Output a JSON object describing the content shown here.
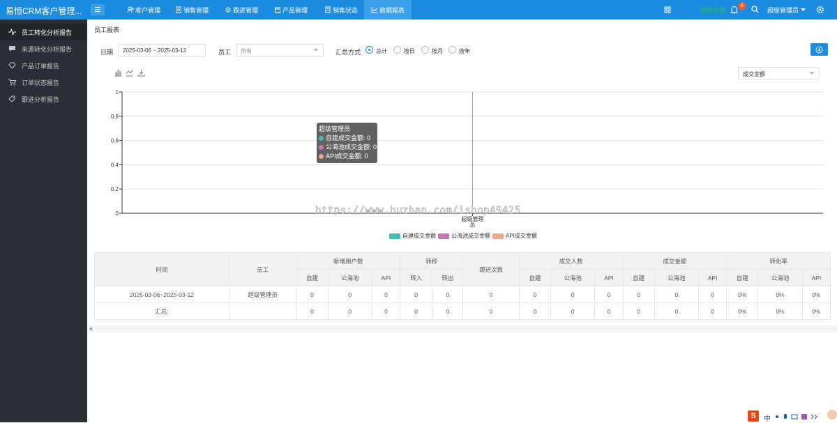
{
  "app": {
    "title": "易恒CRM客户管理..."
  },
  "nav": [
    {
      "label": "客户管理",
      "icon": "users-icon"
    },
    {
      "label": "销售管理",
      "icon": "file-icon"
    },
    {
      "label": "跟进管理",
      "icon": "gear-icon"
    },
    {
      "label": "产品管理",
      "icon": "box-icon"
    },
    {
      "label": "销售状态",
      "icon": "doc-icon"
    },
    {
      "label": "数据报表",
      "icon": "chart-icon",
      "active": true
    }
  ],
  "topright": {
    "consult": "微信咨询",
    "notify_count": "0",
    "user": "超级管理员"
  },
  "sidebar": [
    {
      "label": "员工转化分析报告",
      "icon": "pulse-icon",
      "active": true
    },
    {
      "label": "来源转化分析报告",
      "icon": "comment-icon"
    },
    {
      "label": "产品订单报告",
      "icon": "diamond-icon"
    },
    {
      "label": "订单状态报告",
      "icon": "cart-icon"
    },
    {
      "label": "跟进分析报告",
      "icon": "tag-icon"
    }
  ],
  "breadcrumb": "员工报表",
  "filters": {
    "date_label": "日期",
    "date_value": "2025-03-06 ~ 2025-03-12",
    "staff_label": "员工",
    "staff_value": "所有",
    "mode_label": "汇总方式",
    "modes": [
      "总计",
      "按日",
      "按月",
      "按年"
    ],
    "selected_mode": "总计"
  },
  "metric_select": "成交金额",
  "colors": {
    "primary": "#1c8ce0",
    "sidebar": "#2b2f35",
    "s1": "#3dbfb0",
    "s2": "#c774b5",
    "s3": "#eda88c",
    "consult": "#29c05a"
  },
  "chart_data": {
    "type": "bar",
    "categories": [
      "超级管理员"
    ],
    "series": [
      {
        "name": "自建成交金额",
        "values": [
          0
        ]
      },
      {
        "name": "公海池成交金额",
        "values": [
          0
        ]
      },
      {
        "name": "API成交金额",
        "values": [
          0
        ]
      }
    ],
    "ylim": [
      0,
      1
    ],
    "yticks": [
      "0",
      "0.2",
      "0.4",
      "0.6",
      "0.8",
      "1"
    ],
    "grid": true,
    "legend": "bottom"
  },
  "tooltip": {
    "title": "超级管理员",
    "rows": [
      "自建成交金额: 0",
      "公海池成交金额: 0",
      "API成交金额: 0"
    ]
  },
  "watermark": "https://www.huzhan.com/ishop49425",
  "table": {
    "head_top": [
      "时间",
      "员工",
      "新增用户数",
      "转移",
      "跟进次数",
      "成交人数",
      "成交金额",
      "转化率"
    ],
    "head_sub": [
      "自建",
      "公海池",
      "API",
      "转入",
      "转出",
      "自建",
      "公海池",
      "API",
      "自建",
      "公海池",
      "API",
      "自建",
      "公海池",
      "API"
    ],
    "rows": [
      [
        "2025-03-06~2025-03-12",
        "超级管理员",
        "0",
        "0",
        "0",
        "0",
        "0",
        "0",
        "0",
        "0",
        "0",
        "0",
        "0",
        "0",
        "0%",
        "0%",
        "0%"
      ],
      [
        "汇总:",
        "",
        "0",
        "0",
        "0",
        "0",
        "0",
        "0",
        "0",
        "0",
        "0",
        "0",
        "0",
        "0",
        "0%",
        "0%",
        "0%"
      ]
    ]
  },
  "tray": {
    "ime_lang": "中"
  }
}
